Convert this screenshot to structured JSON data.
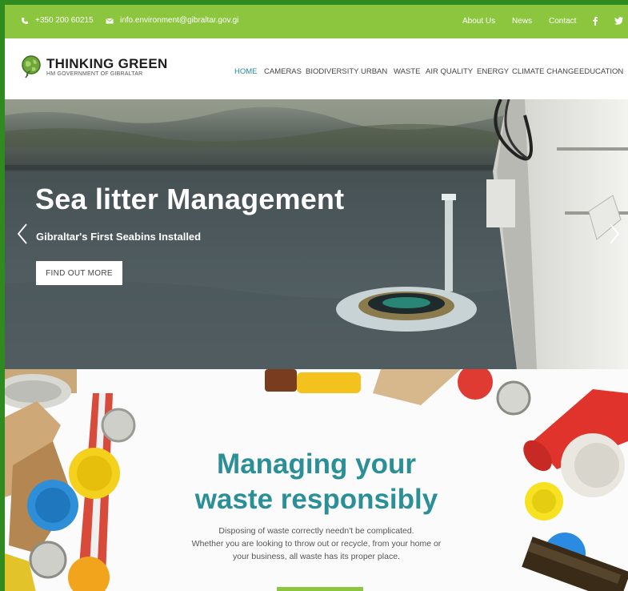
{
  "topbar": {
    "phone": "+350 200 60215",
    "email": "info.environment@gibraltar.gov.gi",
    "links": [
      "About Us",
      "News",
      "Contact"
    ],
    "social": [
      "facebook-icon",
      "twitter-icon"
    ]
  },
  "brand": {
    "title": "THINKING GREEN",
    "subtitle": "HM GOVERNMENT OF GIBRALTAR"
  },
  "nav": [
    "HOME",
    "CAMERAS",
    "BIODIVERSITY",
    "URBAN",
    "WASTE",
    "AIR QUALITY",
    "ENERGY",
    "CLIMATE CHANGE",
    "EDUCATION"
  ],
  "hero": {
    "title": "Sea litter Management",
    "subtitle": "Gibraltar's First Seabins Installed",
    "button": "FIND OUT MORE"
  },
  "waste": {
    "title_line1": "Managing your",
    "title_line2": "waste responsibly",
    "desc_line1": "Disposing of waste correctly needn't be complicated.",
    "desc_line2": "Whether you are looking to throw out or recycle, from your home or",
    "desc_line3": "your business, all waste has its proper place."
  },
  "colors": {
    "accent_green": "#8cc63f",
    "teal": "#2b8f98",
    "frame": "#2f8a1f"
  }
}
